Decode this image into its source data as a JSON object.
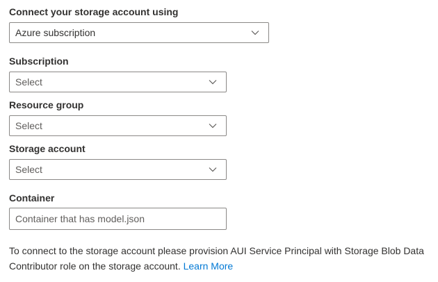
{
  "connect": {
    "label": "Connect your storage account using",
    "selected": "Azure subscription"
  },
  "subscription": {
    "label": "Subscription",
    "selected": "Select"
  },
  "resource_group": {
    "label": "Resource group",
    "selected": "Select"
  },
  "storage_account": {
    "label": "Storage account",
    "selected": "Select"
  },
  "container": {
    "label": "Container",
    "placeholder": "Container that has model.json"
  },
  "info": {
    "text": "To connect to the storage account please provision AUI Service Principal with Storage Blob Data Contributor role on the storage account.",
    "link": "Learn More"
  },
  "icons": {
    "dropdown": "chevron-down-icon"
  },
  "colors": {
    "text": "#323130",
    "border": "#8a8886",
    "link": "#0078d4"
  }
}
